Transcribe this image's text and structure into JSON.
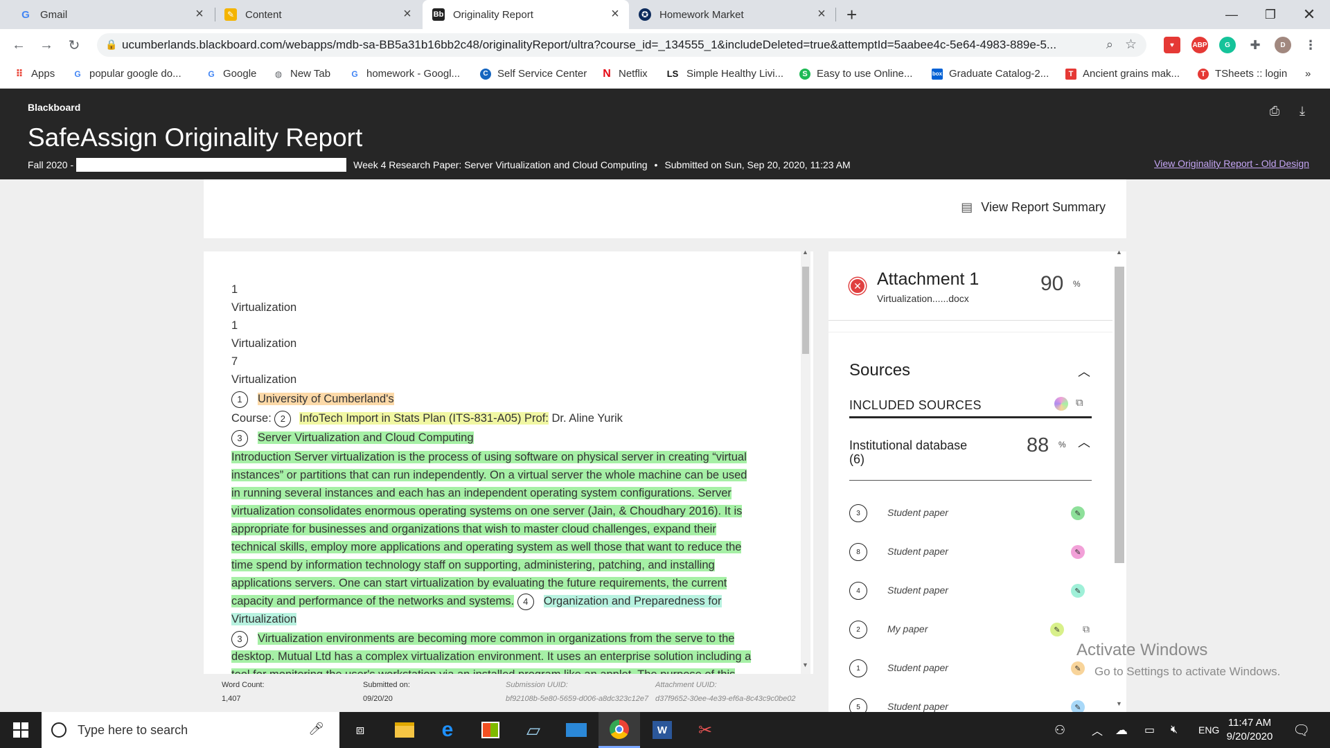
{
  "browser": {
    "tabs": [
      {
        "title": "Gmail",
        "icon": "gmail-icon"
      },
      {
        "title": "Content",
        "icon": "pencil-icon"
      },
      {
        "title": "Originality Report",
        "icon": "blackboard-icon",
        "favicon_text": "Bb",
        "active": true
      },
      {
        "title": "Homework Market",
        "icon": "homework-market-icon"
      }
    ],
    "url": "ucumberlands.blackboard.com/webapps/mdb-sa-BB5a31b16bb2c48/originalityReport/ultra?course_id=_134555_1&includeDeleted=true&attemptId=5aabee4c-5e64-4983-889e-5...",
    "profile_initial": "D",
    "ext_abp": "ABP",
    "bookmarks": [
      {
        "label": "Apps",
        "icon": "apps-grid-icon"
      },
      {
        "label": "popular google do...",
        "icon": "google-icon"
      },
      {
        "label": "Google",
        "icon": "google-icon"
      },
      {
        "label": "New Tab",
        "icon": "globe-icon"
      },
      {
        "label": "homework - Googl...",
        "icon": "google-icon"
      },
      {
        "label": "Self Service Center",
        "icon": "self-service-icon"
      },
      {
        "label": "Netflix",
        "icon": "netflix-icon",
        "icon_text": "N"
      },
      {
        "label": "Simple Healthy Livi...",
        "icon": "ls-icon",
        "icon_text": "LS"
      },
      {
        "label": "Easy to use Online...",
        "icon": "s-icon",
        "icon_text": "S"
      },
      {
        "label": "Graduate Catalog-2...",
        "icon": "box-icon",
        "icon_text": "box"
      },
      {
        "label": "Ancient grains mak...",
        "icon": "t-red-icon",
        "icon_text": "T"
      },
      {
        "label": "TSheets :: login",
        "icon": "tsheets-icon",
        "icon_text": "T"
      }
    ],
    "bookmarks_more": "»"
  },
  "header": {
    "brand": "Blackboard",
    "title": "SafeAssign Originality Report",
    "term": "Fall 2020 -",
    "assignment": "Week 4 Research Paper: Server Virtualization and Cloud Computing",
    "bullet": "•",
    "submitted": "Submitted on Sun, Sep 20, 2020, 11:23 AM",
    "old_design_link": "View Originality Report - Old Design"
  },
  "summary_button": "View Report Summary",
  "document": {
    "line1": "1",
    "line2": "Virtualization",
    "line3": "1",
    "line4": "Virtualization",
    "line5": "7",
    "line6": "Virtualization",
    "c1": "1",
    "t1": "University of Cumberland's",
    "course_label": "Course:",
    "c2": "2",
    "t2": "InfoTech Import in Stats Plan (ITS-831-A05) Prof:",
    "t2_rest": " Dr. Aline Yurik",
    "c3": "3",
    "t3": "Server Virtualization and Cloud Computing",
    "p1": [
      "Introduction Server virtualization is the process of using software on physical server in creating “virtual",
      "instances” or partitions that can run independently. On a virtual server the whole machine can be used",
      "in running several instances and each has an independent operating system configurations. Server",
      "virtualization consolidates enormous operating systems on one server (Jain, & Choudhary 2016). It is",
      "appropriate for businesses and organizations that wish to master cloud challenges, expand their",
      "technical skills, employ more applications and operating system as well those that want to reduce the",
      "time spend by information technology staff on supporting, administering, patching, and installing",
      "applications servers. One can start virtualization by evaluating the future requirements, the current"
    ],
    "p1_last": "capacity and performance of the networks and systems.",
    "c4": "4",
    "t4a": "Organization and Preparedness for",
    "t4b": "Virtualization",
    "c5": "3",
    "p2_first": "Virtualization environments are becoming more common in organizations from the serve to the",
    "p2_second": "desktop. Mutual Ltd has a complex virtualization environment. It uses an enterprise solution including a",
    "p2_third": "tool for monitoring the user's workstation via an installed program like an applet. The purpose of this"
  },
  "footer": {
    "word_count_label": "Word Count:",
    "word_count": "1,407",
    "submitted_label": "Submitted on:",
    "submitted_date": "09/20/20",
    "submission_uuid_label": "Submission UUID:",
    "submission_uuid": "bf92108b-5e80-5659-d006-a8dc323c12e7",
    "attachment_uuid_label": "Attachment UUID:",
    "attachment_uuid": "d37f9652-30ee-4e39-ef6a-8c43c9c0be02"
  },
  "attachment": {
    "title": "Attachment 1",
    "file": "Virtualization......docx",
    "percent": "90",
    "percent_sign": "%"
  },
  "sources": {
    "title": "Sources",
    "included": "INCLUDED SOURCES",
    "institutional": "Institutional database",
    "institutional_count": "(6)",
    "institutional_percent": "88",
    "percent_sign": "%",
    "items": [
      {
        "num": "3",
        "label": "Student paper",
        "color": "#8ee09a"
      },
      {
        "num": "8",
        "label": "Student paper",
        "color": "#f2a0d8"
      },
      {
        "num": "4",
        "label": "Student paper",
        "color": "#9ff0d8"
      },
      {
        "num": "2",
        "label": "My paper",
        "color": "#d8f08a"
      },
      {
        "num": "1",
        "label": "Student paper",
        "color": "#f8d49a"
      },
      {
        "num": "5",
        "label": "Student paper",
        "color": "#a8d8f8"
      }
    ]
  },
  "watermark": {
    "line1": "Activate Windows",
    "line2": "Go to Settings to activate Windows."
  },
  "taskbar": {
    "search_placeholder": "Type here to search",
    "lang": "ENG",
    "time": "11:47 AM",
    "date": "9/20/2020"
  }
}
